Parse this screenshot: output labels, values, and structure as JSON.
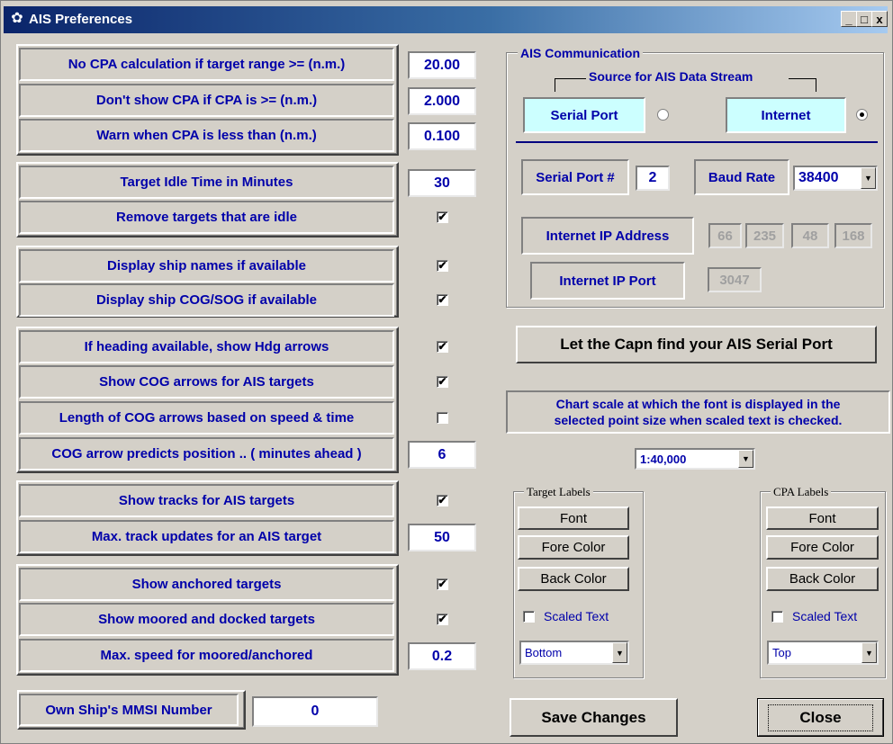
{
  "window": {
    "title": "AIS Preferences",
    "min": "_",
    "max": "□",
    "close": "x"
  },
  "left": {
    "rows": [
      {
        "label": "No CPA calculation if target range >=   (n.m.)",
        "value": "20.00"
      },
      {
        "label": "Don't show CPA if CPA is >=       (n.m.)",
        "value": "2.000"
      },
      {
        "label": "Warn when CPA is less than      (n.m.)",
        "value": "0.100"
      },
      {
        "label": "Target Idle Time in Minutes",
        "value": "30"
      },
      {
        "label": "Remove targets that are idle",
        "checked": true
      },
      {
        "label": "Display ship names if available",
        "checked": true
      },
      {
        "label": "Display ship COG/SOG if available",
        "checked": true
      },
      {
        "label": "If heading available, show Hdg arrows",
        "checked": true
      },
      {
        "label": "Show COG arrows for AIS targets",
        "checked": true
      },
      {
        "label": "Length of COG arrows based on speed & time",
        "checked": false
      },
      {
        "label": "COG arrow predicts position .. ( minutes ahead )",
        "value": "6"
      },
      {
        "label": "Show tracks for AIS targets",
        "checked": true
      },
      {
        "label": "Max. track updates for an AIS target",
        "value": "50"
      },
      {
        "label": "Show anchored targets",
        "checked": true
      },
      {
        "label": "Show moored and docked targets",
        "checked": true
      },
      {
        "label": "Max. speed  for moored/anchored",
        "value": "0.2"
      }
    ],
    "mmsi_label": "Own Ship's MMSI Number",
    "mmsi_value": "0"
  },
  "comm": {
    "title": "AIS Communication",
    "source_title": "Source for AIS Data Stream",
    "serial_port_btn": "Serial Port",
    "internet_btn": "Internet",
    "selected_source": "Internet",
    "serial_port_label": "Serial Port #",
    "serial_port_value": "2",
    "baud_label": "Baud Rate",
    "baud_value": "38400",
    "ip_label": "Internet IP Address",
    "ip_parts": [
      "66",
      "235",
      "48",
      "168"
    ],
    "port_label": "Internet IP Port",
    "port_value": "3047"
  },
  "find_port_btn": "Let the Capn find your AIS Serial Port",
  "chart_scale": {
    "text_line1": "Chart scale at which the font is displayed in the",
    "text_line2": "selected point size when scaled text is checked.",
    "value": "1:40,000"
  },
  "target_labels": {
    "title": "Target Labels",
    "font": "Font",
    "fore": "Fore Color",
    "back": "Back Color",
    "scaled": "Scaled Text",
    "position": "Bottom"
  },
  "cpa_labels": {
    "title": "CPA Labels",
    "font": "Font",
    "fore": "Fore Color",
    "back": "Back Color",
    "scaled": "Scaled Text",
    "position": "Top"
  },
  "save_btn": "Save Changes",
  "close_btn": "Close"
}
